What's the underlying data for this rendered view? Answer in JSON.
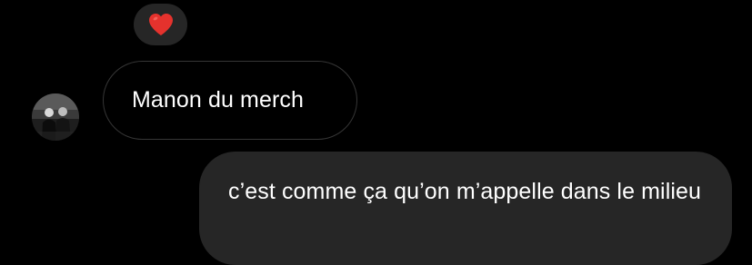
{
  "reaction": {
    "emoji": "❤️",
    "icon": "red-heart-icon",
    "heart_color": "#e5322d"
  },
  "incoming_message": {
    "avatar": "contact-avatar",
    "text": "Manon du merch"
  },
  "outgoing_message": {
    "text": "c’est comme ça qu’on m’appelle dans le milieu"
  },
  "colors": {
    "background": "#000000",
    "outgoing_bubble": "#262626",
    "incoming_bubble_border": "#363636",
    "reaction_pill": "#262626",
    "text": "#ffffff"
  }
}
